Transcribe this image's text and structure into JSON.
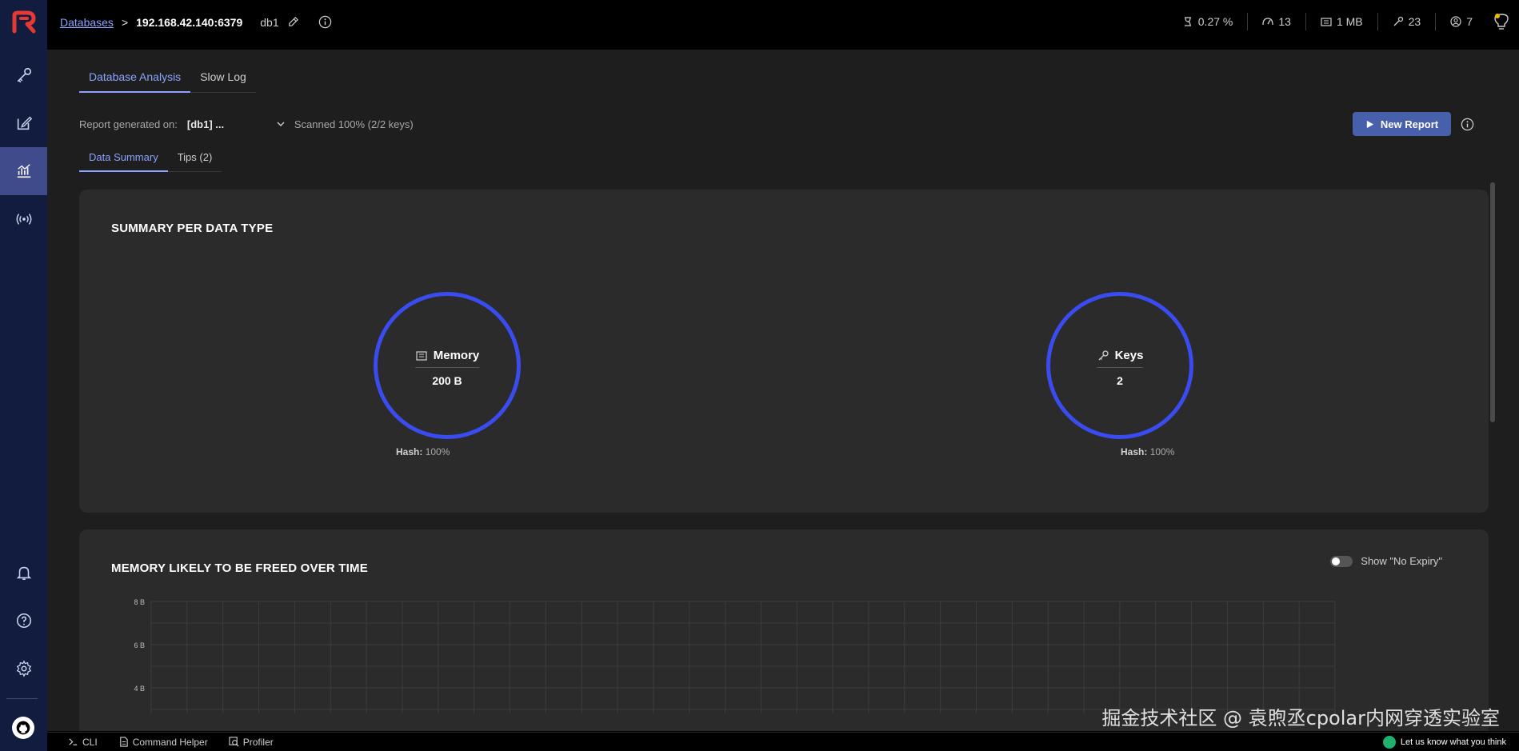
{
  "topbar": {
    "breadcrumb_databases": "Databases",
    "breadcrumb_sep": ">",
    "host": "192.168.42.140:6379",
    "db": "db1",
    "stats": {
      "cpu": "0.27 %",
      "ops": "13",
      "memory": "1 MB",
      "keys": "23",
      "clients": "7"
    }
  },
  "tabs": [
    {
      "label": "Database Analysis"
    },
    {
      "label": "Slow Log"
    }
  ],
  "report": {
    "generated_label": "Report generated on:",
    "selected": "[db1] ...",
    "scanned": "Scanned 100% (2/2 keys)",
    "new_report_label": "New Report"
  },
  "subtabs": [
    {
      "label": "Data Summary"
    },
    {
      "label": "Tips (2)"
    }
  ],
  "summary": {
    "title": "SUMMARY PER DATA TYPE",
    "memory_label": "Memory",
    "memory_value": "200 B",
    "memory_hash_key": "Hash:",
    "memory_hash_value": "100%",
    "keys_label": "Keys",
    "keys_value": "2",
    "keys_hash_key": "Hash:",
    "keys_hash_value": "100%"
  },
  "freed": {
    "title": "MEMORY LIKELY TO BE FREED OVER TIME",
    "toggle_label": "Show \"No Expiry\"",
    "toggle_on": false
  },
  "chart_data": {
    "type": "bar",
    "title": "MEMORY LIKELY TO BE FREED OVER TIME",
    "ytick_labels": [
      "8 B",
      "6 B",
      "4 B"
    ],
    "yticks": [
      8,
      6,
      4
    ],
    "series": []
  },
  "bottombar": {
    "cli": "CLI",
    "command_helper": "Command Helper",
    "profiler": "Profiler",
    "feedback": "Let us know what you think"
  },
  "watermark": "掘金技术社区 @ 袁煦丞cpolar内网穿透实验室",
  "colors": {
    "accent": "#8ba2ff",
    "circle": "#3a4cf0",
    "sidebar": "#121c3e",
    "button": "#485fac"
  }
}
